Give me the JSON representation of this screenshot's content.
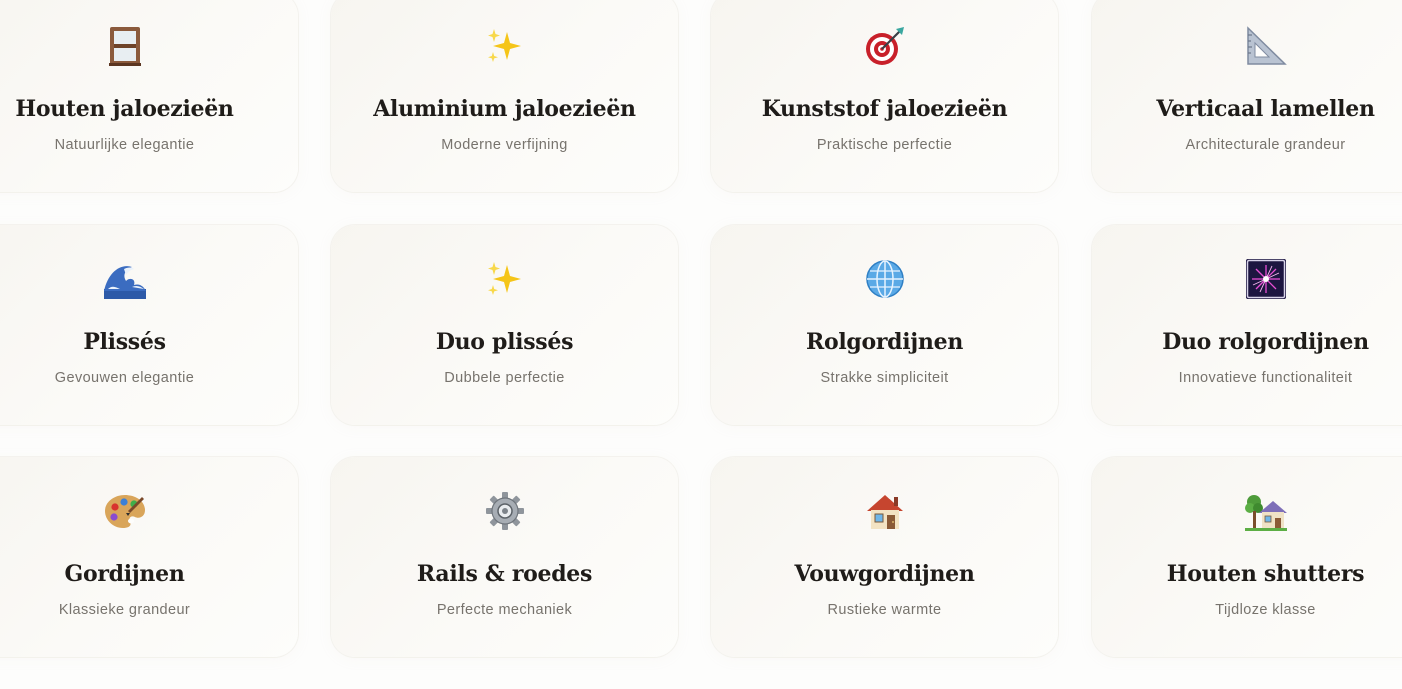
{
  "cards": [
    {
      "title": "Houten jaloezieën",
      "subtitle": "Natuurlijke elegantie",
      "icon": "window-icon"
    },
    {
      "title": "Aluminium jaloezieën",
      "subtitle": "Moderne verfijning",
      "icon": "sparkles-icon"
    },
    {
      "title": "Kunststof jaloezieën",
      "subtitle": "Praktische perfectie",
      "icon": "target-icon"
    },
    {
      "title": "Verticaal lamellen",
      "subtitle": "Architecturale grandeur",
      "icon": "triangle-ruler-icon"
    },
    {
      "title": "Plissés",
      "subtitle": "Gevouwen elegantie",
      "icon": "wave-icon"
    },
    {
      "title": "Duo plissés",
      "subtitle": "Dubbele perfectie",
      "icon": "sparkles-icon"
    },
    {
      "title": "Rolgordijnen",
      "subtitle": "Strakke simpliciteit",
      "icon": "globe-icon"
    },
    {
      "title": "Duo rolgordijnen",
      "subtitle": "Innovatieve functionaliteit",
      "icon": "firework-icon"
    },
    {
      "title": "Gordijnen",
      "subtitle": "Klassieke grandeur",
      "icon": "palette-icon"
    },
    {
      "title": "Rails & roedes",
      "subtitle": "Perfecte mechaniek",
      "icon": "gear-icon"
    },
    {
      "title": "Vouwgordijnen",
      "subtitle": "Rustieke warmte",
      "icon": "house-icon"
    },
    {
      "title": "Houten shutters",
      "subtitle": "Tijdloze klasse",
      "icon": "house-garden-icon"
    }
  ],
  "colors": {
    "title": "#1f1c19",
    "subtitle": "#77736d",
    "card_bg": "#f8f6f1"
  }
}
